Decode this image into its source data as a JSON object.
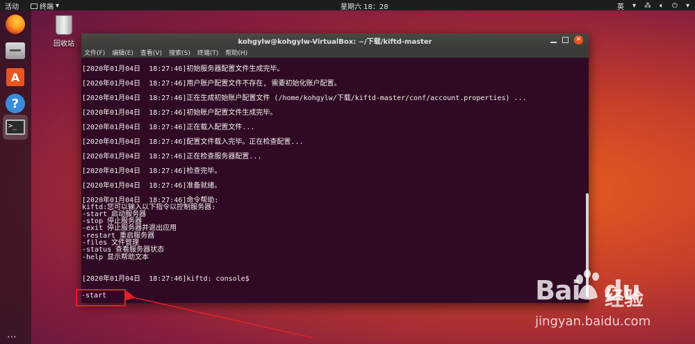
{
  "topbar": {
    "activities": "活动",
    "app_menu": "终端",
    "clock": "星期六 18：28",
    "input_method": "英"
  },
  "dock": {
    "items": [
      {
        "name": "firefox-icon"
      },
      {
        "name": "files-icon"
      },
      {
        "name": "software-store-icon"
      },
      {
        "name": "help-icon"
      },
      {
        "name": "terminal-icon"
      }
    ],
    "show_apps": "⋯"
  },
  "desktop": {
    "trash_label": "回收站"
  },
  "window": {
    "title": "kohgylw@kohgylw-VirtualBox: ~/下载/kiftd-master",
    "menu": [
      "文件(F)",
      "编辑(E)",
      "查看(V)",
      "搜索(S)",
      "终端(T)",
      "帮助(H)"
    ]
  },
  "terminal": {
    "lines": [
      "[2020年01月04日  18:27:46]初始服务器配置文件生成完毕。",
      "[2020年01月04日  18:27:46]用户账户配置文件不存在, 需要初始化账户配置。",
      "[2020年01月04日  18:27:46]正在生成初始账户配置文件 (/home/kohgylw/下载/kiftd-master/conf/account.properties) ...",
      "[2020年01月04日  18:27:46]初始账户配置文件生成完毕。",
      "[2020年01月04日  18:27:46]正在载入配置文件...",
      "[2020年01月04日  18:27:46]配置文件载入完毕。正在检查配置...",
      "[2020年01月04日  18:27:46]正在检查服务器配置...",
      "[2020年01月04日  18:27:46]检查完毕。",
      "[2020年01月04日  18:27:46]准备就绪。",
      "[2020年01月04日  18:27:46]命令帮助:",
      "kiftd:您可以输入以下指令以控制服务器:",
      "-start 启动服务器",
      "-stop 停止服务器",
      "-exit 停止服务器并退出应用",
      "-restart 重启服务器",
      "-files 文件管理",
      "-status 查看服务器状态",
      "-help 显示帮助文本",
      "[2020年01月04日  18:27:46]kiftd: console$"
    ],
    "typed_command": "-start"
  },
  "annotation": {
    "highlight_color": "#e0202a"
  },
  "watermark": {
    "logo_text": "Bai",
    "logo_text2": "du",
    "cn_text": "经验",
    "url": "jingyan.baidu.com"
  }
}
